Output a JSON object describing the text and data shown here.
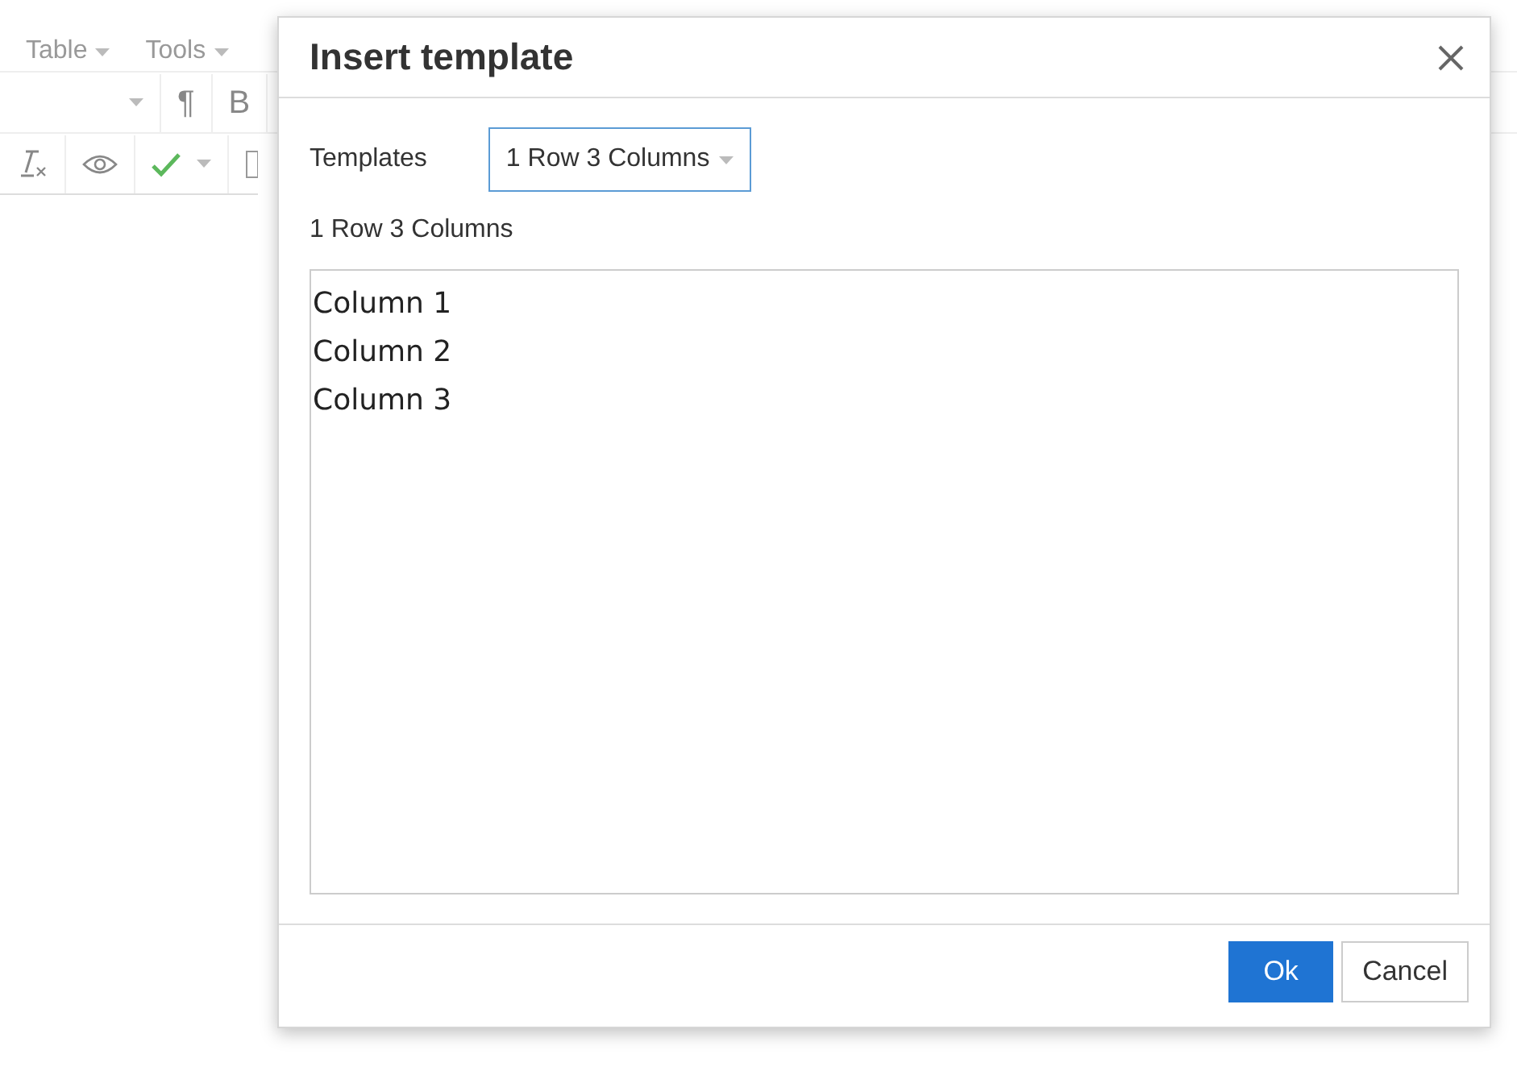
{
  "menu": [
    {
      "label": "Table"
    },
    {
      "label": "Tools"
    }
  ],
  "toolbar_row_1": [
    {
      "label": "¶"
    },
    {
      "label": "B"
    }
  ],
  "dialog": {
    "title": "Insert template",
    "templates_label": "Templates",
    "template_select": {
      "value": "1 Row 3 Columns"
    },
    "description": "1 Row 3 Columns",
    "preview_lines": [
      "Column 1",
      "Column 2",
      "Column 3"
    ],
    "buttons": [
      {
        "label": "Ok",
        "kind": "primary"
      },
      {
        "label": "Cancel",
        "kind": "secondary"
      }
    ]
  }
}
